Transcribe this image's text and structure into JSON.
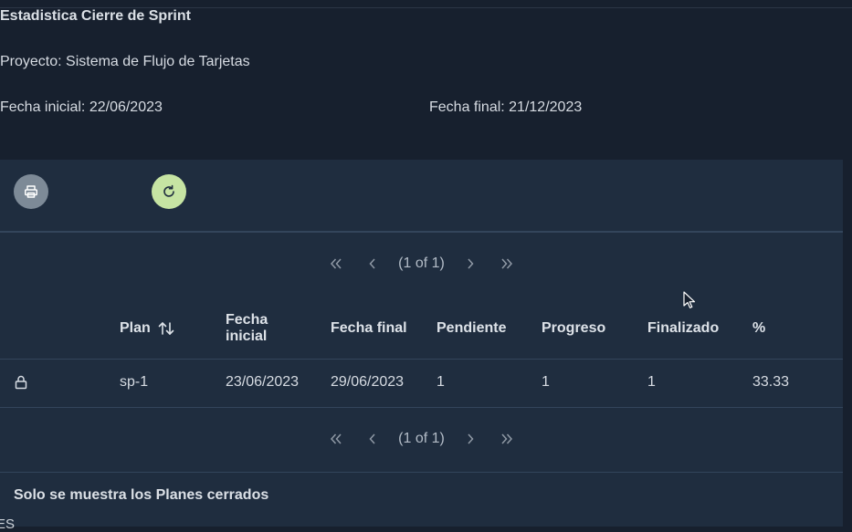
{
  "report": {
    "title": "Estadistica Cierre de Sprint",
    "project": "Proyecto: Sistema de Flujo de Tarjetas",
    "start_date": "Fecha inicial: 22/06/2023",
    "end_date": "Fecha final: 21/12/2023"
  },
  "toolbar": {
    "print_icon": "printer-icon",
    "refresh_icon": "refresh-icon",
    "print_color": "#7d8a97",
    "refresh_color": "#c6e4a3"
  },
  "paginator": {
    "page_info": "(1 of 1)"
  },
  "table": {
    "headers": {
      "plan": "Plan",
      "fecha_inicial": "Fecha inicial",
      "fecha_final": "Fecha final",
      "pendiente": "Pendiente",
      "progreso": "Progreso",
      "finalizado": "Finalizado",
      "percent": "%"
    },
    "rows": [
      {
        "icon": "lock-icon",
        "plan": "sp-1",
        "fecha_inicial": "23/06/2023",
        "fecha_final": "29/06/2023",
        "pendiente": "1",
        "progreso": "1",
        "finalizado": "1",
        "percent": "33.33"
      }
    ]
  },
  "footer": {
    "note": "Solo se muestra los Planes cerrados"
  },
  "language": "ES"
}
